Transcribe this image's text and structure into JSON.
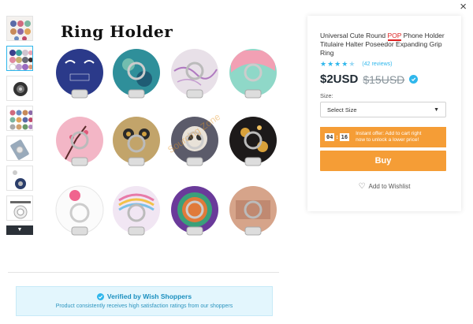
{
  "close_label": "×",
  "thumbnails": [
    {
      "name": "thumb-1"
    },
    {
      "name": "thumb-2"
    },
    {
      "name": "thumb-3"
    },
    {
      "name": "thumb-4"
    },
    {
      "name": "thumb-5"
    },
    {
      "name": "thumb-6"
    },
    {
      "name": "thumb-7"
    }
  ],
  "thumb_down_icon": "▼",
  "main_image": {
    "title": "Ring Holder",
    "watermark": "Sourcing Zone"
  },
  "product": {
    "title_before": "Universal Cute Round ",
    "title_highlight": "POP",
    "title_after": " Phone Holder Titulaire Halter Poseedor Expanding Grip Ring",
    "rating_stars": 4.5,
    "reviews": "(42 reviews)",
    "price": "$2USD",
    "old_price": "$15USD",
    "size_label": "Size:",
    "size_select": "Select Size",
    "timer": [
      "04",
      "16"
    ],
    "offer_text": "Instant offer: Add to cart right now to unlock a lower price!",
    "buy_label": "Buy",
    "wishlist_label": "Add to Wishlist"
  },
  "verified": {
    "title": "Verified by Wish Shoppers",
    "subtitle": "Product consistently receives high satisfaction ratings from our shoppers"
  },
  "colors": {
    "accent": "#2fb7ec",
    "orange": "#f59d36",
    "verified_bg": "#e3f6fd"
  }
}
